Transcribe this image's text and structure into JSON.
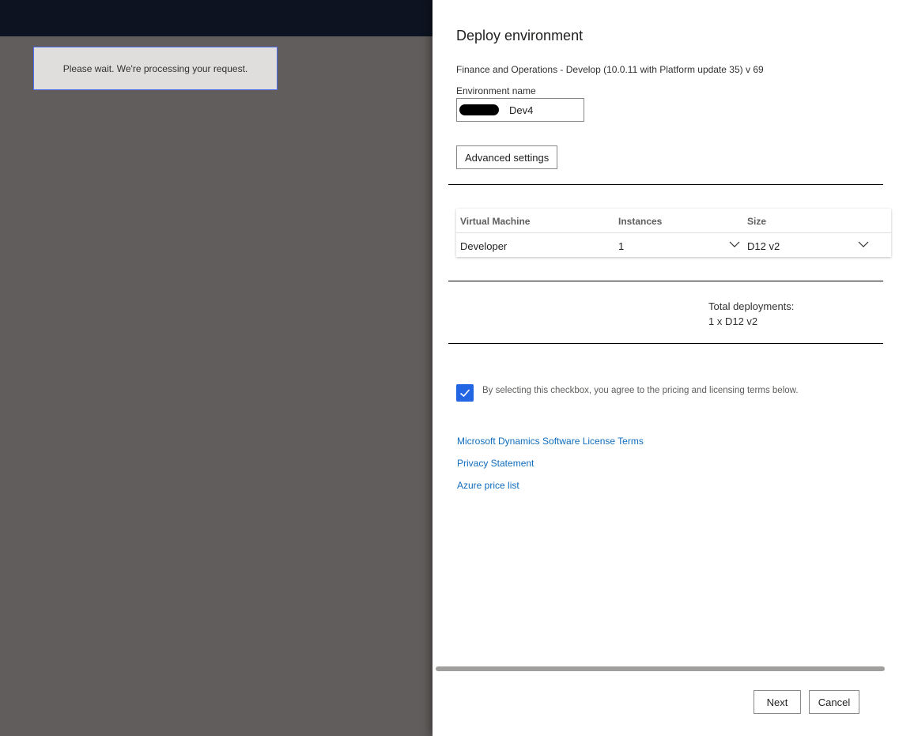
{
  "background": {
    "loading_message": "Please wait. We're processing your request."
  },
  "panel": {
    "title": "Deploy environment",
    "subtitle": "Finance and Operations - Develop (10.0.11 with Platform update 35) v 69",
    "environment_name": {
      "label": "Environment name",
      "value": "Dev4"
    },
    "advanced_settings_label": "Advanced settings",
    "vm_table": {
      "headers": [
        "Virtual Machine",
        "Instances",
        "Size"
      ],
      "rows": [
        {
          "vm": "Developer",
          "instances": "1",
          "size": "D12 v2"
        }
      ]
    },
    "totals": {
      "label": "Total deployments:",
      "value": "1 x D12 v2"
    },
    "agreement": {
      "checked": true,
      "text": "By selecting this checkbox, you agree to the pricing and licensing terms below."
    },
    "links": [
      "Microsoft Dynamics Software License Terms",
      "Privacy Statement",
      "Azure price list"
    ],
    "next_label": "Next",
    "cancel_label": "Cancel"
  },
  "colors": {
    "accent": "#2266e3",
    "link": "#0f6cbd",
    "overlay": "#615d5c",
    "topbar": "#0d1320"
  },
  "icons": [
    "chevron-down-icon",
    "checkmark-icon"
  ]
}
